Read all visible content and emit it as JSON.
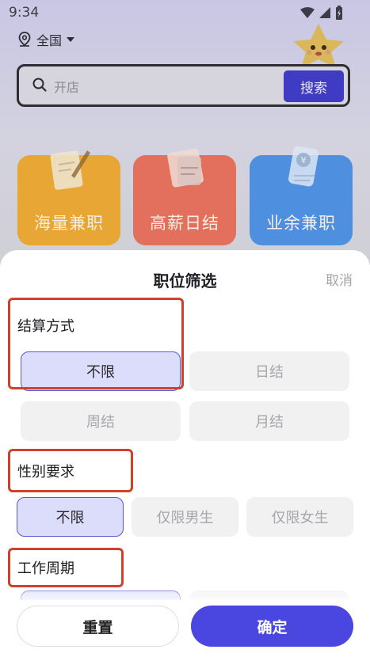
{
  "status_bar": {
    "time": "9:34"
  },
  "location": {
    "label": "全国"
  },
  "search": {
    "placeholder": "开店",
    "button_label": "搜索"
  },
  "cards": [
    {
      "label": "海量兼职",
      "color": "#e8a634"
    },
    {
      "label": "高薪日结",
      "color": "#e3705c"
    },
    {
      "label": "业余兼职",
      "color": "#4f8fe0"
    }
  ],
  "sheet": {
    "title": "职位筛选",
    "cancel": "取消",
    "sections": [
      {
        "title": "结算方式",
        "options": [
          "不限",
          "日结",
          "周结",
          "月结"
        ],
        "selected": "不限"
      },
      {
        "title": "性别要求",
        "options": [
          "不限",
          "仅限男生",
          "仅限女生"
        ],
        "selected": "不限"
      },
      {
        "title": "工作周期",
        "options": [],
        "selected": ""
      }
    ],
    "reset": "重置",
    "confirm": "确定"
  }
}
